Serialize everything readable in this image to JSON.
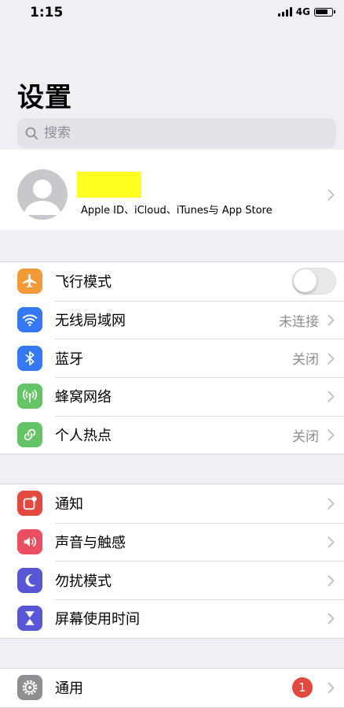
{
  "status_bar": {
    "time": "1:15",
    "network": "4G",
    "signal_icon": "signal-bars-icon",
    "battery_icon": "battery-icon"
  },
  "header": {
    "title": "设置"
  },
  "search": {
    "placeholder": "搜索",
    "icon": "search-icon"
  },
  "profile": {
    "subtitle": "Apple ID、iCloud、iTunes与 App Store",
    "name_redaction_color": "#ffff22"
  },
  "groups": [
    {
      "rows": [
        {
          "label": "飞行模式",
          "icon": "airplane-icon",
          "icon_color": "#f19a37",
          "toggle": false
        },
        {
          "label": "无线局域网",
          "icon": "wifi-icon",
          "icon_color": "#3478f6",
          "value": "未连接"
        },
        {
          "label": "蓝牙",
          "icon": "bluetooth-icon",
          "icon_color": "#3478f6",
          "value": "关闭"
        },
        {
          "label": "蜂窝网络",
          "icon": "cellular-icon",
          "icon_color": "#65c466"
        },
        {
          "label": "个人热点",
          "icon": "hotspot-icon",
          "icon_color": "#65c466",
          "value": "关闭"
        }
      ]
    },
    {
      "rows": [
        {
          "label": "通知",
          "icon": "notifications-icon",
          "icon_color": "#e5483f"
        },
        {
          "label": "声音与触感",
          "icon": "sound-icon",
          "icon_color": "#ea4e61"
        },
        {
          "label": "勿扰模式",
          "icon": "moon-icon",
          "icon_color": "#5856d6"
        },
        {
          "label": "屏幕使用时间",
          "icon": "hourglass-icon",
          "icon_color": "#5856d6"
        }
      ]
    },
    {
      "rows": [
        {
          "label": "通用",
          "icon": "gear-icon",
          "icon_color": "#8e8e93",
          "badge": "1"
        }
      ]
    }
  ]
}
